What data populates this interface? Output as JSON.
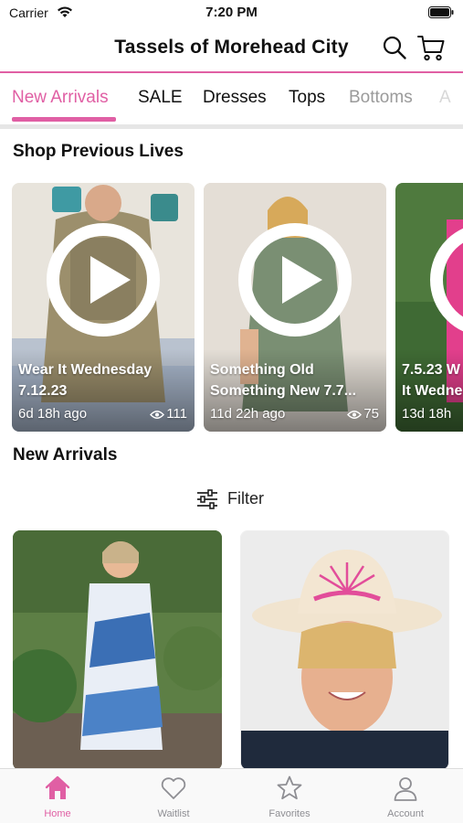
{
  "status_bar": {
    "carrier": "Carrier",
    "time": "7:20 PM"
  },
  "header": {
    "title": "Tassels of Morehead City"
  },
  "tabs": [
    {
      "label": "New Arrivals",
      "active": true
    },
    {
      "label": "SALE"
    },
    {
      "label": "Dresses"
    },
    {
      "label": "Tops"
    },
    {
      "label": "Bottoms"
    },
    {
      "label": "A"
    }
  ],
  "sections": {
    "previous_lives": "Shop Previous Lives",
    "new_arrivals": "New Arrivals"
  },
  "lives": [
    {
      "title": "Wear It Wednesday\n7.12.23",
      "ago": "6d 18h ago",
      "views": "111"
    },
    {
      "title": "Something Old\nSomething New 7.7...",
      "ago": "11d 22h ago",
      "views": "75"
    },
    {
      "title": "7.5.23 W\nIt Wedne",
      "ago": "13d 18h",
      "views": ""
    }
  ],
  "filter": {
    "label": "Filter"
  },
  "bottom_nav": [
    {
      "label": "Home",
      "icon": "home-icon",
      "active": true
    },
    {
      "label": "Waitlist",
      "icon": "heart-icon"
    },
    {
      "label": "Favorites",
      "icon": "star-icon"
    },
    {
      "label": "Account",
      "icon": "person-icon"
    }
  ],
  "colors": {
    "accent": "#e05fa4",
    "inactive": "#8e8e93"
  }
}
